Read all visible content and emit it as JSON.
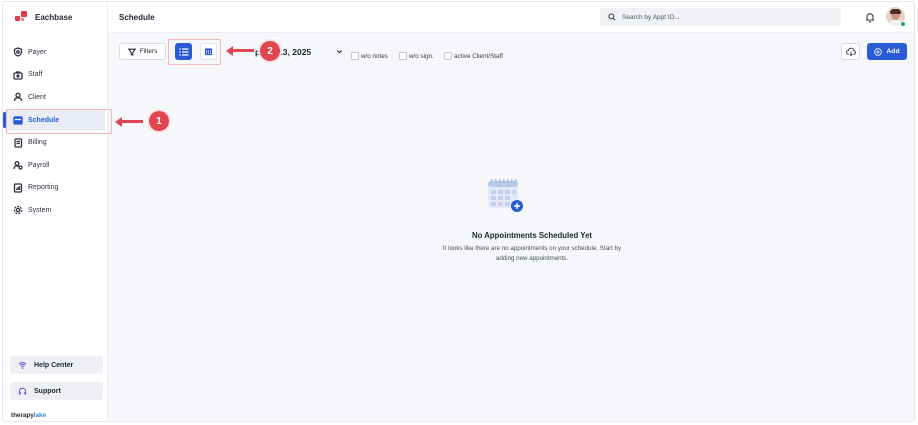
{
  "app": {
    "brand": "Eachbase",
    "footer_brand_a": "therapy",
    "footer_brand_b": "lake"
  },
  "header": {
    "title": "Schedule",
    "search_placeholder": "Search by Appt ID..."
  },
  "sidebar": {
    "items": [
      {
        "label": "Payer",
        "icon": "shield-icon"
      },
      {
        "label": "Staff",
        "icon": "staff-icon"
      },
      {
        "label": "Client",
        "icon": "user-icon"
      },
      {
        "label": "Schedule",
        "icon": "calendar-icon",
        "active": true
      },
      {
        "label": "Billing",
        "icon": "billing-icon"
      },
      {
        "label": "Payroll",
        "icon": "payroll-icon"
      },
      {
        "label": "Reporting",
        "icon": "report-icon"
      },
      {
        "label": "System",
        "icon": "gear-icon"
      }
    ],
    "help_center": "Help Center",
    "support": "Support"
  },
  "toolbar": {
    "filters": "Filters",
    "date_partial": "p",
    "date": "pr 13, 2025",
    "checkboxes": [
      "w/o notes",
      "w/o sign.",
      "active Client/Staff"
    ],
    "add": "Add"
  },
  "empty_state": {
    "title": "No Appointments Scheduled Yet",
    "description": "It looks like there are no appointments on your schedule. Start by adding new appointments."
  },
  "annotations": {
    "badge_1": "1",
    "badge_2": "2"
  },
  "colors": {
    "accent": "#2a5bd7",
    "annotation": "#e0464f",
    "brand": "#e23a4a"
  }
}
